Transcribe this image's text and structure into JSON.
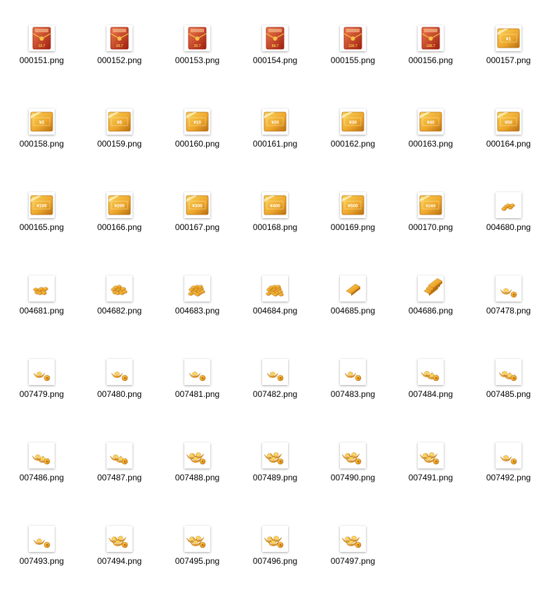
{
  "files": [
    {
      "name": "000151.png",
      "icon": "red-envelope-icon",
      "label": "10.7"
    },
    {
      "name": "000152.png",
      "icon": "red-envelope-icon",
      "label": "20.7"
    },
    {
      "name": "000153.png",
      "icon": "red-envelope-icon",
      "label": "30.7"
    },
    {
      "name": "000154.png",
      "icon": "red-envelope-icon",
      "label": "88.7"
    },
    {
      "name": "000155.png",
      "icon": "red-envelope-icon",
      "label": "100.7"
    },
    {
      "name": "000156.png",
      "icon": "red-envelope-icon",
      "label": "188.7"
    },
    {
      "name": "000157.png",
      "icon": "gold-coupon-icon",
      "label": "¥1"
    },
    {
      "name": "000158.png",
      "icon": "gold-coupon-icon",
      "label": "¥2"
    },
    {
      "name": "000159.png",
      "icon": "gold-coupon-icon",
      "label": "¥5"
    },
    {
      "name": "000160.png",
      "icon": "gold-coupon-icon",
      "label": "¥10"
    },
    {
      "name": "000161.png",
      "icon": "gold-coupon-icon",
      "label": "¥20"
    },
    {
      "name": "000162.png",
      "icon": "gold-coupon-icon",
      "label": "¥30"
    },
    {
      "name": "000163.png",
      "icon": "gold-coupon-icon",
      "label": "¥40"
    },
    {
      "name": "000164.png",
      "icon": "gold-coupon-icon",
      "label": "¥50"
    },
    {
      "name": "000165.png",
      "icon": "gold-coupon-icon",
      "label": "¥100"
    },
    {
      "name": "000166.png",
      "icon": "gold-coupon-icon",
      "label": "¥200"
    },
    {
      "name": "000167.png",
      "icon": "gold-coupon-icon",
      "label": "¥300"
    },
    {
      "name": "000168.png",
      "icon": "gold-coupon-icon",
      "label": "¥400"
    },
    {
      "name": "000169.png",
      "icon": "gold-coupon-icon",
      "label": "¥500"
    },
    {
      "name": "000170.png",
      "icon": "gold-coupon-icon",
      "label": "¥1000"
    },
    {
      "name": "004680.png",
      "icon": "gold-coins-icon",
      "level": 1
    },
    {
      "name": "004681.png",
      "icon": "gold-coins-icon",
      "level": 2
    },
    {
      "name": "004682.png",
      "icon": "gold-coins-icon",
      "level": 3
    },
    {
      "name": "004683.png",
      "icon": "gold-coins-icon",
      "level": 4
    },
    {
      "name": "004684.png",
      "icon": "gold-coins-icon",
      "level": 5
    },
    {
      "name": "004685.png",
      "icon": "gold-bar-icon",
      "level": 1
    },
    {
      "name": "004686.png",
      "icon": "gold-bar-icon",
      "level": 3
    },
    {
      "name": "007478.png",
      "icon": "gold-ingot-icon",
      "level": 1
    },
    {
      "name": "007479.png",
      "icon": "gold-ingot-icon",
      "level": 1
    },
    {
      "name": "007480.png",
      "icon": "gold-ingot-icon",
      "level": 1
    },
    {
      "name": "007481.png",
      "icon": "gold-ingot-icon",
      "level": 1
    },
    {
      "name": "007482.png",
      "icon": "gold-ingot-icon",
      "level": 1
    },
    {
      "name": "007483.png",
      "icon": "gold-ingot-icon",
      "level": 1
    },
    {
      "name": "007484.png",
      "icon": "gold-ingot-icon",
      "level": 2
    },
    {
      "name": "007485.png",
      "icon": "gold-ingot-icon",
      "level": 2
    },
    {
      "name": "007486.png",
      "icon": "gold-ingot-icon",
      "level": 2
    },
    {
      "name": "007487.png",
      "icon": "gold-ingot-icon",
      "level": 2
    },
    {
      "name": "007488.png",
      "icon": "gold-ingot-icon",
      "level": 3
    },
    {
      "name": "007489.png",
      "icon": "gold-ingot-icon",
      "level": 3
    },
    {
      "name": "007490.png",
      "icon": "gold-ingot-icon",
      "level": 3
    },
    {
      "name": "007491.png",
      "icon": "gold-ingot-icon",
      "level": 3
    },
    {
      "name": "007492.png",
      "icon": "gold-ingot-icon",
      "level": 1
    },
    {
      "name": "007493.png",
      "icon": "gold-ingot-icon",
      "level": 1
    },
    {
      "name": "007494.png",
      "icon": "gold-ingot-icon",
      "level": 3
    },
    {
      "name": "007495.png",
      "icon": "gold-ingot-icon",
      "level": 3
    },
    {
      "name": "007496.png",
      "icon": "gold-ingot-icon",
      "level": 3
    },
    {
      "name": "007497.png",
      "icon": "gold-ingot-icon",
      "level": 3
    }
  ],
  "colors": {
    "gold_light": "#fbd45a",
    "gold": "#eca52a",
    "gold_dark": "#b86f12",
    "red_light": "#f07a4a",
    "red": "#d9361e",
    "red_dark": "#9e1f10",
    "label_text": "#000000"
  }
}
